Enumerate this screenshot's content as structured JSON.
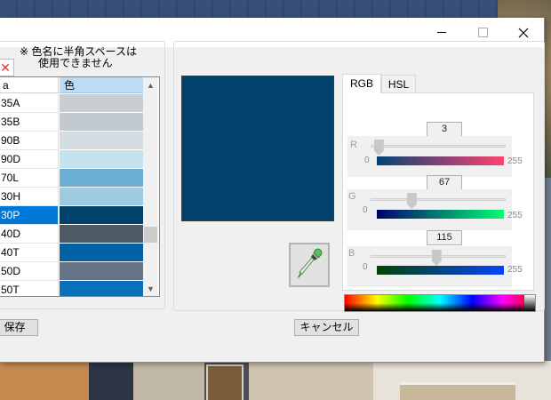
{
  "window": {
    "note_line1": "※ 色名に半角スペースは",
    "note_line2": "使用できません"
  },
  "color_list": {
    "header_name": "a",
    "header_color": "色",
    "rows": [
      {
        "name": "35A",
        "color": "#c9ced3"
      },
      {
        "name": "35B",
        "color": "#c3cacf"
      },
      {
        "name": "90B",
        "color": "#d3dde2"
      },
      {
        "name": "90D",
        "color": "#c4e3ee"
      },
      {
        "name": "70L",
        "color": "#6aafd3"
      },
      {
        "name": "30H",
        "color": "#9dcce0"
      },
      {
        "name": "30P",
        "color": "#03416d"
      },
      {
        "name": "40D",
        "color": "#4d5a66"
      },
      {
        "name": "40T",
        "color": "#0061a3"
      },
      {
        "name": "50D",
        "color": "#657587"
      },
      {
        "name": "50T",
        "color": "#0a70b8"
      }
    ],
    "selected_index": 6
  },
  "buttons": {
    "save_label": "保存",
    "cancel_label": "キャンセル"
  },
  "preview": {
    "color": "#03416d"
  },
  "tabs": [
    {
      "label": "RGB",
      "active": true
    },
    {
      "label": "HSL",
      "active": false
    }
  ],
  "rgb": {
    "r": {
      "label": "R",
      "value": "3",
      "min": "0",
      "max": "255",
      "fraction": 0.012
    },
    "g": {
      "label": "G",
      "value": "67",
      "min": "0",
      "max": "255",
      "fraction": 0.263
    },
    "b": {
      "label": "B",
      "value": "115",
      "min": "0",
      "max": "255",
      "fraction": 0.451
    }
  },
  "icons": {
    "eyedropper": "eyedropper-icon",
    "delete": "delete-x-icon",
    "close": "close-icon",
    "minimize": "minimize-icon",
    "maximize": "maximize-icon"
  }
}
